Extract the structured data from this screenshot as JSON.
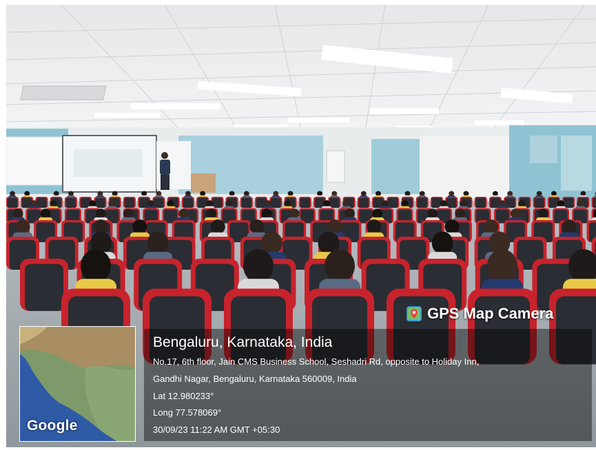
{
  "overlay": {
    "camera_app_label": "GPS Map Camera",
    "camera_icon": "gps-map-camera-icon",
    "map_attribution": "Google",
    "place_title": "Bengaluru, Karnataka, India",
    "address_line1": "No.17, 6th floor, Jain CMS Business School, Seshadri Rd, opposite to Holiday Inn,",
    "address_line2": "Gandhi Nagar, Bengaluru, Karnataka 560009, India",
    "latitude": "Lat 12.980233°",
    "longitude": "Long 77.578069°",
    "timestamp": "30/09/23 11:22 AM GMT +05:30"
  },
  "colors": {
    "seat_red": "#c8232c",
    "seat_back": "#2a2d33",
    "ceiling": "#eeeeef",
    "wall_teal": "#8fc3d3"
  }
}
